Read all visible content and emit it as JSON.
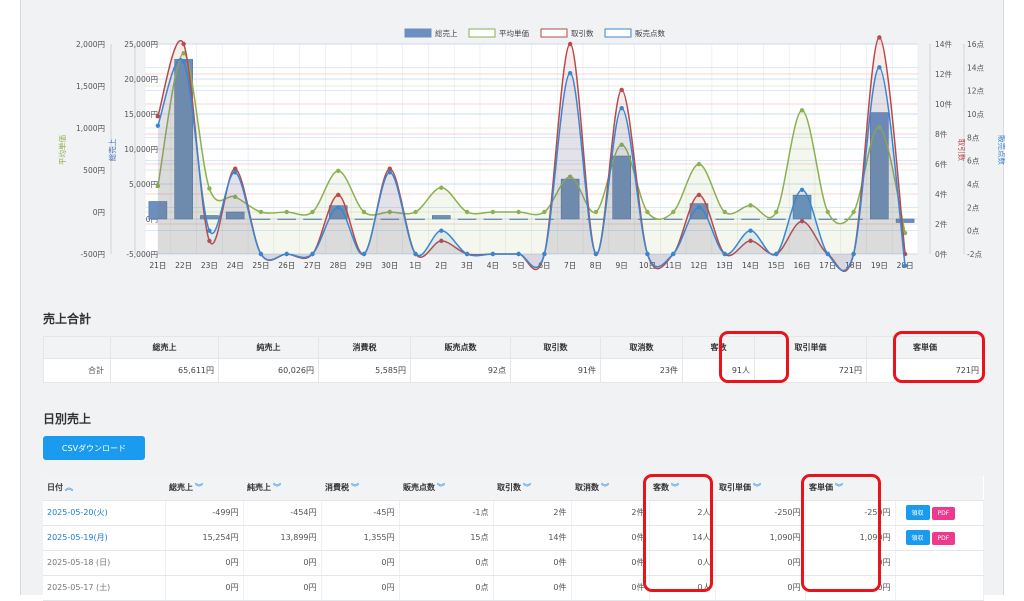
{
  "chart_data": {
    "type": "bar",
    "categories": [
      "21日",
      "22日",
      "23日",
      "24日",
      "25日",
      "26日",
      "27日",
      "28日",
      "29日",
      "30日",
      "1日",
      "2日",
      "3日",
      "4日",
      "5日",
      "6日",
      "7日",
      "8日",
      "9日",
      "10日",
      "11日",
      "12日",
      "13日",
      "14日",
      "15日",
      "16日",
      "17日",
      "18日",
      "19日",
      "20日"
    ],
    "series": [
      {
        "name": "総売上",
        "type": "bar",
        "axis": "left1",
        "color": "#6a8fc0",
        "values": [
          2500,
          22800,
          500,
          1000,
          0,
          0,
          0,
          1900,
          0,
          0,
          0,
          500,
          0,
          0,
          0,
          0,
          5700,
          0,
          9000,
          0,
          0,
          2200,
          0,
          0,
          0,
          3400,
          0,
          0,
          15200,
          -500
        ]
      },
      {
        "name": "平均単価",
        "type": "line",
        "axis": "left2",
        "color": "#8cb050",
        "values": [
          310,
          1890,
          280,
          180,
          0,
          0,
          0,
          490,
          0,
          0,
          0,
          290,
          0,
          0,
          0,
          0,
          420,
          0,
          800,
          0,
          0,
          570,
          0,
          80,
          0,
          1210,
          0,
          0,
          1010,
          -250
        ]
      },
      {
        "name": "取引数",
        "type": "line",
        "axis": "right1",
        "color": "#b84a4a",
        "values": [
          8.5,
          14,
          -1,
          4.5,
          -2,
          -2,
          -2,
          2.5,
          -2,
          4.5,
          -2,
          -1,
          -2,
          -2,
          -2,
          -2,
          14,
          -2,
          10.5,
          -2,
          -2,
          2.5,
          -2,
          -1,
          -2,
          0.5,
          -2,
          -2,
          14.5,
          -2
        ]
      },
      {
        "name": "販売点数",
        "type": "line",
        "axis": "right2",
        "color": "#3a86d0",
        "values": [
          9,
          14.5,
          0,
          5,
          -2,
          -2,
          -2,
          2,
          -2,
          5,
          -2,
          0,
          -2,
          -2,
          -2,
          -2,
          13.5,
          -2,
          10.5,
          -2,
          -2,
          2,
          -2,
          0,
          -2,
          3.5,
          -2,
          -2,
          14,
          -3
        ]
      }
    ],
    "axes": {
      "left1": {
        "label": "総売上",
        "ticks": [
          "25,000円",
          "20,000円",
          "15,000円",
          "10,000円",
          "5,000円",
          "0円",
          "-5,000円"
        ],
        "min": -5000,
        "max": 25000
      },
      "left2": {
        "label": "平均単価",
        "ticks": [
          "2,000円",
          "1,500円",
          "1,000円",
          "500円",
          "0円",
          "-500円"
        ],
        "min": -500,
        "max": 2000
      },
      "right1": {
        "label": "取引数",
        "ticks": [
          "14件",
          "12件",
          "10件",
          "8件",
          "6件",
          "4件",
          "2件",
          "0件"
        ],
        "min": -2,
        "max": 14
      },
      "right2": {
        "label": "販売点数",
        "ticks": [
          "16点",
          "14点",
          "12点",
          "10点",
          "8点",
          "6点",
          "4点",
          "2点",
          "0点",
          "-2点"
        ],
        "min": -2,
        "max": 16
      }
    },
    "legend_position": "top-center",
    "grid": true
  },
  "summary": {
    "title": "売上合計",
    "headers": [
      "",
      "総売上",
      "純売上",
      "消費税",
      "販売点数",
      "取引数",
      "取消数",
      "客数",
      "取引単価",
      "客単価"
    ],
    "row": [
      "合計",
      "65,611円",
      "60,026円",
      "5,585円",
      "92点",
      "91件",
      "23件",
      "91人",
      "721円",
      "721円"
    ]
  },
  "daily": {
    "title": "日別売上",
    "csv_button": "CSVダウンロード",
    "headers": [
      "日付",
      "総売上",
      "純売上",
      "消費税",
      "販売点数",
      "取引数",
      "取消数",
      "客数",
      "取引単価",
      "客単価",
      ""
    ],
    "rows": [
      [
        "2025-05-20(火)",
        "-499円",
        "-454円",
        "-45円",
        "-1点",
        "2件",
        "2件",
        "2人",
        "-250円",
        "-250円"
      ],
      [
        "2025-05-19(月)",
        "15,254円",
        "13,899円",
        "1,355円",
        "15点",
        "14件",
        "0件",
        "14人",
        "1,090円",
        "1,090円"
      ],
      [
        "2025-05-18 (日)",
        "0円",
        "0円",
        "0円",
        "0点",
        "0件",
        "0件",
        "0人",
        "0円",
        "0円"
      ],
      [
        "2025-05-17 (土)",
        "0円",
        "0円",
        "0円",
        "0点",
        "0件",
        "0件",
        "0人",
        "0円",
        "0円"
      ]
    ],
    "receipt_label": "領収",
    "pdf_label": "PDF"
  },
  "colors": {
    "accent": "#1a9bef",
    "pdf": "#ee3a8c",
    "highlight": "#e8131b"
  }
}
